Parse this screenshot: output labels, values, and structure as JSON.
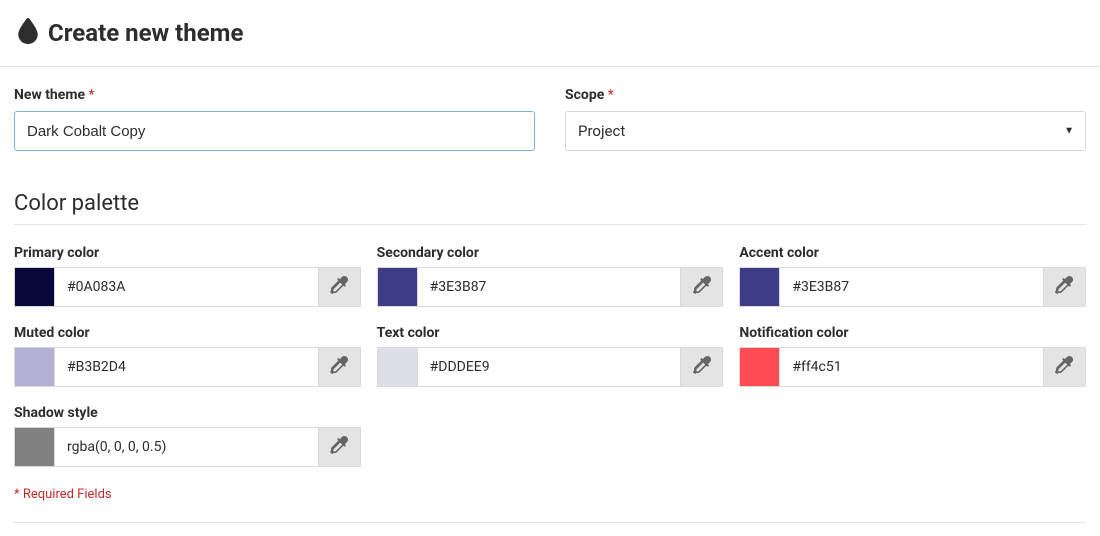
{
  "header": {
    "title": "Create new theme",
    "icon": "tint-icon"
  },
  "form": {
    "theme_name": {
      "label": "New theme",
      "required": true,
      "value": "Dark Cobalt Copy"
    },
    "scope": {
      "label": "Scope",
      "required": true,
      "value": "Project"
    }
  },
  "palette": {
    "section_title": "Color palette",
    "colors": [
      {
        "key": "primary",
        "label": "Primary color",
        "value": "#0A083A",
        "swatch": "#0A083A"
      },
      {
        "key": "secondary",
        "label": "Secondary color",
        "value": "#3E3B87",
        "swatch": "#3E3B87"
      },
      {
        "key": "accent",
        "label": "Accent color",
        "value": "#3E3B87",
        "swatch": "#3E3B87"
      },
      {
        "key": "muted",
        "label": "Muted color",
        "value": "#B3B2D4",
        "swatch": "#B3B2D4"
      },
      {
        "key": "text",
        "label": "Text color",
        "value": "#DDDEE9",
        "swatch": "#DDDEE9"
      },
      {
        "key": "notification",
        "label": "Notification color",
        "value": "#ff4c51",
        "swatch": "#ff4c51"
      },
      {
        "key": "shadow",
        "label": "Shadow style",
        "value": "rgba(0, 0, 0, 0.5)",
        "swatch": "#808080"
      }
    ]
  },
  "required_note": "* Required Fields",
  "star": " *"
}
